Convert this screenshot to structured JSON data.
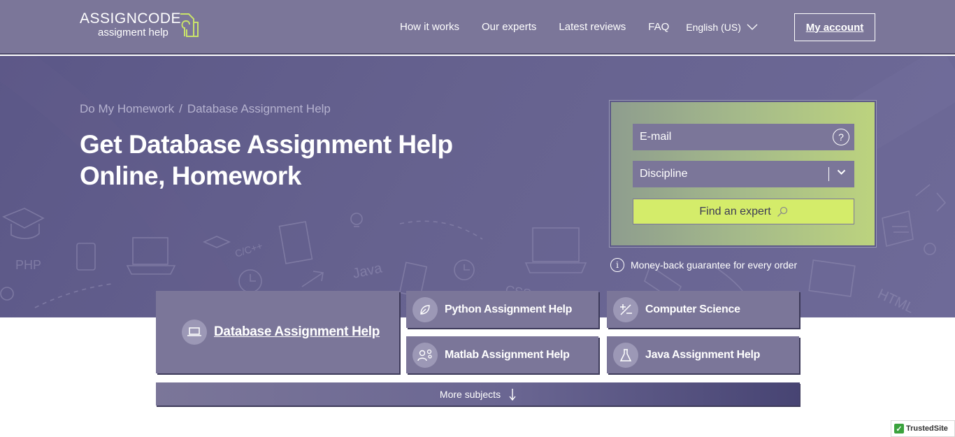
{
  "header": {
    "logo_title": "ASSIGNCODE",
    "logo_subtitle": "assigment help",
    "nav": [
      "How it works",
      "Our experts",
      "Latest reviews",
      "FAQ"
    ],
    "language": "English (US)",
    "account_label": "My account"
  },
  "hero": {
    "breadcrumb": [
      "Do My Homework",
      "Database Assignment Help"
    ],
    "breadcrumb_sep": "/",
    "title": "Get Database Assignment Help Online, Homework",
    "doodle_words": [
      "PHP",
      "C/C++",
      "Java",
      "CSS",
      "HTML"
    ]
  },
  "form": {
    "email_placeholder": "E-mail",
    "help_symbol": "?",
    "discipline_label": "Discipline",
    "find_label": "Find an expert"
  },
  "guarantee": {
    "icon_text": "i",
    "text": "Money-back guarantee for every order"
  },
  "subjects": {
    "main": "Database Assignment Help",
    "items": [
      "Python Assignment Help",
      "Computer Science",
      "Matlab Assignment Help",
      "Java Assignment Help"
    ],
    "more": "More subjects"
  },
  "badge": {
    "text": "TrustedSite",
    "mark": "✓"
  },
  "colors": {
    "header_bg": "#7b7699",
    "hero_bg": "#5b5787",
    "accent_green": "#d4ec6a",
    "logo_green": "#c9e36a"
  }
}
